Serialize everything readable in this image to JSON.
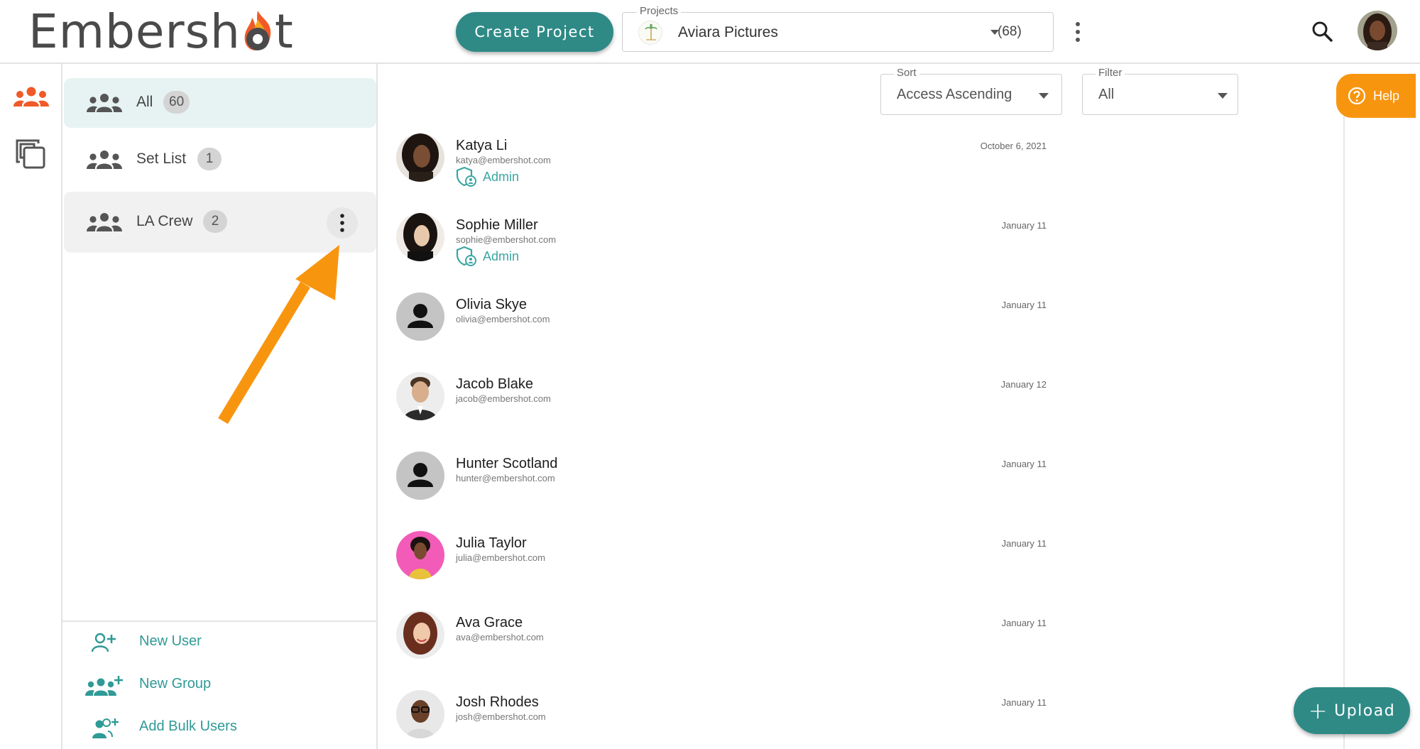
{
  "app": {
    "logo_text": "Embersh",
    "logo_text_end": "t"
  },
  "header": {
    "create_project_label": "Create Project",
    "projects_label": "Projects",
    "project_name": "Aviara Pictures",
    "project_count": "(68)"
  },
  "groups": {
    "items": [
      {
        "label": "All",
        "count": "60"
      },
      {
        "label": "Set List",
        "count": "1"
      },
      {
        "label": "LA Crew",
        "count": "2"
      }
    ],
    "actions": [
      {
        "label": "New User"
      },
      {
        "label": "New Group"
      },
      {
        "label": "Add Bulk Users"
      }
    ]
  },
  "toolbar": {
    "sort_label": "Sort",
    "sort_value": "Access Ascending",
    "filter_label": "Filter",
    "filter_value": "All"
  },
  "users": [
    {
      "name": "Katya Li",
      "email": "katya@embershot.com",
      "role": "Admin",
      "date": "October 6, 2021"
    },
    {
      "name": "Sophie Miller",
      "email": "sophie@embershot.com",
      "role": "Admin",
      "date": "January 11"
    },
    {
      "name": "Olivia Skye",
      "email": "olivia@embershot.com",
      "role": "",
      "date": "January 11"
    },
    {
      "name": "Jacob Blake",
      "email": "jacob@embershot.com",
      "role": "",
      "date": "January 12"
    },
    {
      "name": "Hunter Scotland",
      "email": "hunter@embershot.com",
      "role": "",
      "date": "January 11"
    },
    {
      "name": "Julia Taylor",
      "email": "julia@embershot.com",
      "role": "",
      "date": "January 11"
    },
    {
      "name": "Ava Grace",
      "email": "ava@embershot.com",
      "role": "",
      "date": "January 11"
    },
    {
      "name": "Josh Rhodes",
      "email": "josh@embershot.com",
      "role": "",
      "date": "January 11"
    }
  ],
  "help_label": "Help",
  "upload_label": "Upload",
  "colors": {
    "teal": "#2f8a86",
    "teal_text": "#3ba6a1",
    "orange": "#f8950f",
    "ember": "#f05a28"
  }
}
